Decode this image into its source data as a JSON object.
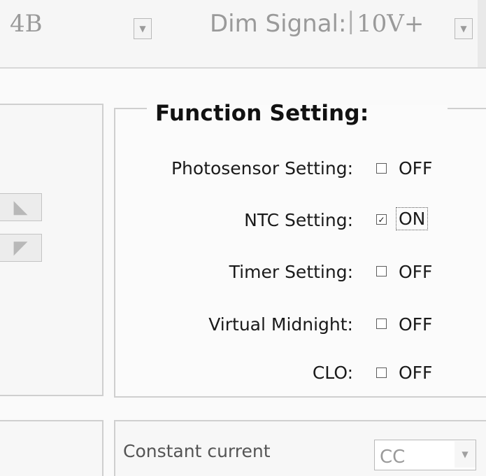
{
  "toolbar": {
    "left_value": "4B",
    "dim_signal_label": "Dim Signal:",
    "dim_signal_value": "10V+"
  },
  "function_setting": {
    "title": "Function Setting:",
    "rows": [
      {
        "label": "Photosensor Setting:",
        "state": "OFF",
        "checked": false
      },
      {
        "label": "NTC Setting:",
        "state": "ON",
        "checked": true
      },
      {
        "label": "Timer Setting:",
        "state": "OFF",
        "checked": false
      },
      {
        "label": "Virtual Midnight:",
        "state": "OFF",
        "checked": false
      },
      {
        "label": "CLO:",
        "state": "OFF",
        "checked": false
      }
    ]
  },
  "output_mode": {
    "label": "Constant current",
    "value": "CC"
  },
  "icons": {
    "check": "✓",
    "dropdown": "dropdown-arrow-icon",
    "spin_up": "spin-up-icon",
    "spin_down": "spin-down-icon"
  }
}
